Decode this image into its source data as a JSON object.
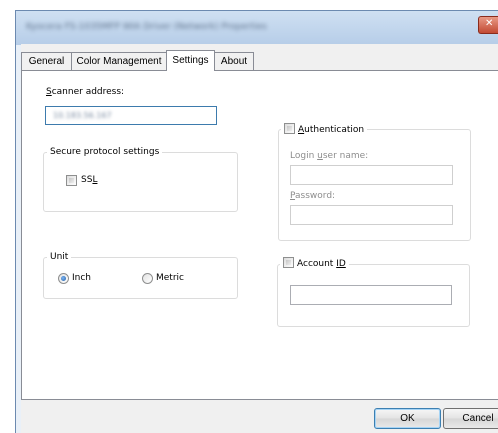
{
  "window": {
    "title": "Kyocera FS-1035MFP WIA Driver (Network) Properties",
    "close_glyph": "✕",
    "accent_color": "#3c7fb1"
  },
  "tabs": [
    {
      "label": "General",
      "active": false
    },
    {
      "label": "Color Management",
      "active": false
    },
    {
      "label": "Settings",
      "active": true
    },
    {
      "label": "About",
      "active": false
    }
  ],
  "scanner_address": {
    "label_prefix": "",
    "label_accel": "S",
    "label_rest": "canner address:",
    "value": "10.183.56.167"
  },
  "secure_protocol": {
    "legend": "Secure protocol settings",
    "ssl": {
      "label_prefix": "SS",
      "label_accel": "L",
      "label_rest": "",
      "checked": false
    }
  },
  "unit": {
    "legend": "Unit",
    "options": [
      {
        "label": "Inch",
        "checked": true
      },
      {
        "label": "Metric",
        "checked": false
      }
    ]
  },
  "authentication": {
    "label_prefix": "",
    "label_accel": "A",
    "label_rest": "uthentication",
    "checked": false,
    "login_label_prefix": "Login ",
    "login_label_accel": "u",
    "login_label_rest": "ser name:",
    "login_value": "",
    "password_label_prefix": "",
    "password_label_accel": "P",
    "password_label_rest": "assword:",
    "password_value": ""
  },
  "account_id": {
    "label_prefix": "Account ",
    "label_accel": "ID",
    "label_rest": "",
    "checked": false,
    "value": ""
  },
  "buttons": {
    "ok": "OK",
    "cancel": "Cancel"
  }
}
